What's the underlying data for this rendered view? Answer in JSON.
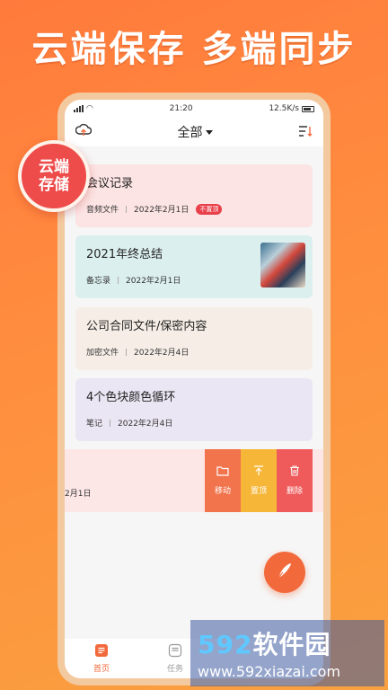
{
  "headline": "云端保存 多端同步",
  "stamp": {
    "line1": "云端",
    "line2": "存储"
  },
  "status": {
    "time": "21:20",
    "speed": "12.5K/s"
  },
  "appbar": {
    "title": "全部"
  },
  "cards": [
    {
      "title": "会议记录",
      "type": "音频文件",
      "date": "2022年2月1日",
      "badge": "不置顶",
      "bg": "#fde4e4"
    },
    {
      "title": "2021年终总结",
      "type": "备忘录",
      "date": "2022年2月1日",
      "bg": "#dcefef"
    },
    {
      "title": "公司合同文件/保密内容",
      "type": "加密文件",
      "date": "2022年2月4日",
      "bg": "#f6eee6"
    },
    {
      "title": "4个色块颜色循环",
      "type": "笔记",
      "date": "2022年2月4日",
      "bg": "#ebe6f3"
    }
  ],
  "swipe": {
    "partial_date": "2月1日",
    "actions": [
      {
        "label": "移动",
        "color": "#f2744d"
      },
      {
        "label": "置顶",
        "color": "#f6b638"
      },
      {
        "label": "删除",
        "color": "#ef5b5b"
      }
    ]
  },
  "tabs": [
    {
      "label": "首页",
      "color": "#f26a3c"
    },
    {
      "label": "任务",
      "color": "#999999"
    }
  ],
  "watermark": {
    "brand_num": "592",
    "brand_text": "软件园",
    "url": "www.592xiazai.com"
  }
}
